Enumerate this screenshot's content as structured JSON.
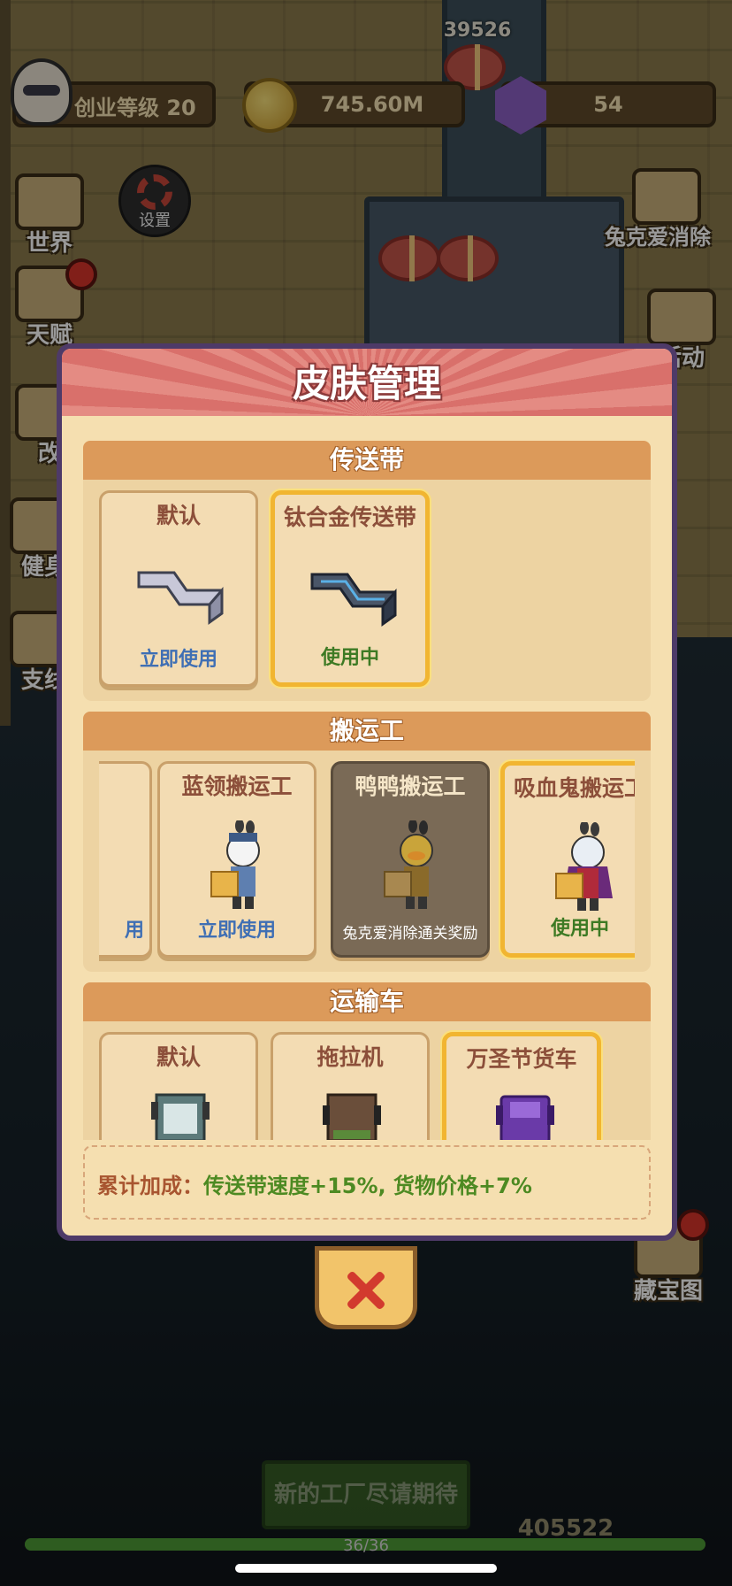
{
  "hud": {
    "level_label": "创业等级 20",
    "coins": "745.60M",
    "gems": "54",
    "top_score": "39526"
  },
  "side_buttons": {
    "world": "世界",
    "settings": "设置",
    "talent": "天赋",
    "renovate": "改",
    "fitness": "健身",
    "branch": "支线",
    "match_game": "兔克爱消除",
    "event": "活动",
    "treasure_map": "藏宝图"
  },
  "modal": {
    "title": "皮肤管理",
    "sections": [
      {
        "title": "传送带",
        "cards": [
          {
            "name": "默认",
            "action": "立即使用"
          },
          {
            "name": "钛合金传送带",
            "action": "使用中"
          }
        ]
      },
      {
        "title": "搬运工",
        "cards": [
          {
            "name": "",
            "action": "用"
          },
          {
            "name": "蓝领搬运工",
            "action": "立即使用"
          },
          {
            "name": "鸭鸭搬运工",
            "action": "兔克爱消除通关奖励"
          },
          {
            "name": "吸血鬼搬运工",
            "action": "使用中"
          }
        ]
      },
      {
        "title": "运输车",
        "cards": [
          {
            "name": "默认",
            "action": ""
          },
          {
            "name": "拖拉机",
            "action": ""
          },
          {
            "name": "万圣节货车",
            "action": ""
          }
        ]
      }
    ],
    "bonus_label": "累计加成：",
    "bonus_value": "传送带速度+15%, 货物价格+7%"
  },
  "bottom": {
    "new_factory_label": "新的工厂尽请期待",
    "progress_text": "36/36",
    "progress_fraction": 1.0,
    "bottom_score": "405522"
  },
  "colors": {
    "modal_bg": "#f5dfb0",
    "header_pink": "#d9706b",
    "section_header": "#dc9a5a",
    "selected_border": "#f1b531",
    "use_blue": "#3f6fb4",
    "in_use_green": "#3d7a24"
  }
}
